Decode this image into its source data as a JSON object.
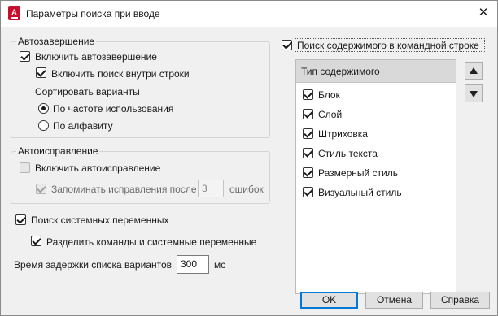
{
  "window": {
    "title": "Параметры поиска при вводе",
    "close_glyph": "✕"
  },
  "autocomplete": {
    "legend": "Автозавершение",
    "enable_label": "Включить автозавершение",
    "inner_search_label": "Включить поиск внутри строки",
    "sort_label": "Сортировать варианты",
    "sort_options": [
      {
        "label": "По частоте использования",
        "selected": true
      },
      {
        "label": "По алфавиту",
        "selected": false
      }
    ]
  },
  "autocorrect": {
    "legend": "Автоисправление",
    "enable_label": "Включить автоисправление",
    "remember_label": "Запоминать исправления после",
    "errors_value": "3",
    "errors_unit": "ошибок"
  },
  "system_vars": {
    "search_label": "Поиск системных переменных",
    "separate_label": "Разделить команды и системные переменные"
  },
  "delay": {
    "label": "Время задержки списка вариантов",
    "value": "300",
    "unit": "мс"
  },
  "content_search": {
    "label": "Поиск содержимого в командной строке",
    "list_header": "Тип содержимого",
    "items": [
      {
        "label": "Блок",
        "checked": true
      },
      {
        "label": "Слой",
        "checked": true
      },
      {
        "label": "Штриховка",
        "checked": true
      },
      {
        "label": "Стиль текста",
        "checked": true
      },
      {
        "label": "Размерный стиль",
        "checked": true
      },
      {
        "label": "Визуальный стиль",
        "checked": true
      }
    ]
  },
  "buttons": {
    "ok": "OK",
    "cancel": "Отмена",
    "help": "Справка"
  },
  "icons": {
    "app": "autocad-icon",
    "move_up": "arrow-up-icon",
    "move_down": "arrow-down-icon"
  },
  "colors": {
    "accent": "#0078d7",
    "app_icon": "#c8102e"
  }
}
